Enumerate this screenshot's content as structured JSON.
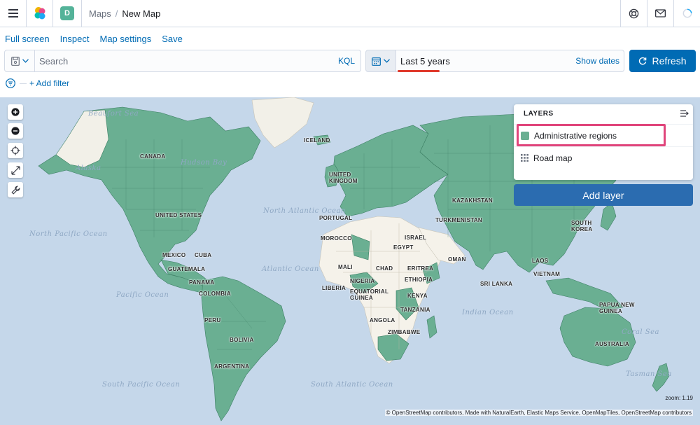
{
  "header": {
    "space_initial": "D",
    "breadcrumbs": [
      "Maps",
      "New Map"
    ]
  },
  "menu": {
    "items": [
      "Full screen",
      "Inspect",
      "Map settings",
      "Save"
    ]
  },
  "query": {
    "search_placeholder": "Search",
    "language": "KQL",
    "date_range": "Last 5 years",
    "show_dates": "Show dates",
    "refresh": "Refresh"
  },
  "filters": {
    "add_filter": "+ Add filter"
  },
  "map": {
    "ocean_labels": [
      "North Pacific Ocean",
      "North Atlantic Ocean",
      "Atlantic Ocean",
      "Pacific Ocean",
      "Indian Ocean",
      "South Pacific Ocean",
      "South Atlantic Ocean",
      "Coral Sea",
      "Tasman Sea",
      "Hudson Bay",
      "Beaufort Sea"
    ],
    "country_labels": [
      "CANADA",
      "UNITED STATES",
      "MEXICO",
      "CUBA",
      "GUATEMALA",
      "PANAMA",
      "COLOMBIA",
      "PERU",
      "BOLIVIA",
      "ARGENTINA",
      "ICELAND",
      "UNITED KINGDOM",
      "PORTUGAL",
      "MOROCCO",
      "MALI",
      "CHAD",
      "EGYPT",
      "ISRAEL",
      "ERITREA",
      "ETHIOPIA",
      "LIBERIA",
      "NIGERIA",
      "EQUATORIAL GUINEA",
      "KENYA",
      "TANZANIA",
      "ANGOLA",
      "ZIMBABWE",
      "KAZAKHSTAN",
      "TURKMENISTAN",
      "OMAN",
      "SRI LANKA",
      "SOUTH KOREA",
      "LAOS",
      "VIETNAM",
      "PAPUA NEW GUINEA",
      "AUSTRALIA",
      "Alaska"
    ],
    "zoom_text": "zoom: 1.19",
    "attribution": "© OpenStreetMap contributors, Made with NaturalEarth, Elastic Maps Service, OpenMapTiles, OpenStreetMap contributors"
  },
  "layers": {
    "title": "LAYERS",
    "items": [
      "Administrative regions",
      "Road map"
    ],
    "add_layer": "Add layer"
  },
  "colors": {
    "accent": "#006bb4",
    "land_fill": "#6aaf92",
    "ocean": "#c5d7ea",
    "highlight": "#e0457b"
  }
}
